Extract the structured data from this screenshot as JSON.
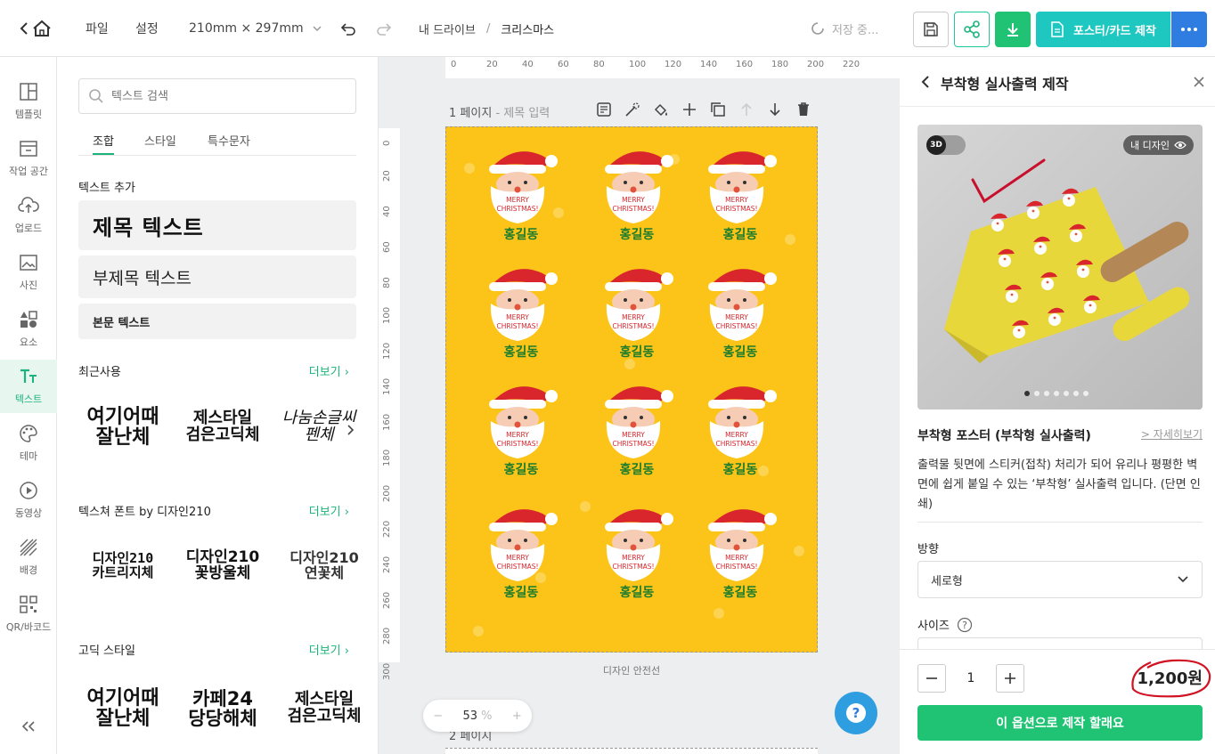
{
  "topbar": {
    "menu_file": "파일",
    "menu_settings": "설정",
    "paper_size": "210mm × 297mm",
    "breadcrumb_root": "내 드라이브",
    "breadcrumb_sep": "/",
    "breadcrumb_current": "크리스마스",
    "save_status": "저장 중...",
    "poster_button": "포스터/카드 제작"
  },
  "leftnav": {
    "items": [
      {
        "label": "템플릿",
        "icon": "template-icon"
      },
      {
        "label": "작업 공간",
        "icon": "workspace-icon"
      },
      {
        "label": "업로드",
        "icon": "upload-icon"
      },
      {
        "label": "사진",
        "icon": "photo-icon"
      },
      {
        "label": "요소",
        "icon": "elements-icon"
      },
      {
        "label": "텍스트",
        "icon": "text-icon"
      },
      {
        "label": "테마",
        "icon": "theme-icon"
      },
      {
        "label": "동영상",
        "icon": "video-icon"
      },
      {
        "label": "배경",
        "icon": "background-icon"
      },
      {
        "label": "QR/바코드",
        "icon": "qr-icon"
      }
    ],
    "active": "텍스트"
  },
  "textpanel": {
    "search_placeholder": "텍스트 검색",
    "tabs": [
      "조합",
      "스타일",
      "특수문자"
    ],
    "add_text_label": "텍스트 추가",
    "heading_text": "제목 텍스트",
    "subheading_text": "부제목 텍스트",
    "body_text": "본문 텍스트",
    "recent_label": "최근사용",
    "more_label": "더보기",
    "texture_label": "텍스쳐 폰트 by 디자인210",
    "gothic_label": "고딕 스타일",
    "recent_fonts": [
      {
        "line1": "여기어때",
        "line2": "잘난체"
      },
      {
        "line1": "제스타일",
        "line2": "검은고딕체"
      },
      {
        "line1": "나눔손글씨",
        "line2": "펜체"
      }
    ],
    "texture_fonts": [
      {
        "line1": "디자인210",
        "line2": "카트리지체"
      },
      {
        "line1": "디자인210",
        "line2": "꽃방울체"
      },
      {
        "line1": "디자인210",
        "line2": "연꽃체"
      }
    ],
    "gothic_fonts": [
      {
        "line1": "여기어때",
        "line2": "잘난체"
      },
      {
        "line1": "카페24",
        "line2": "당당해체"
      },
      {
        "line1": "제스타일",
        "line2": "검은고딕체"
      }
    ]
  },
  "canvas": {
    "page1_label": "1 페이지",
    "page1_title_placeholder": "- 제목 입력",
    "safe_line_label": "디자인 안전선",
    "page2_label": "2 페이지",
    "zoom_value": "53",
    "zoom_unit": "%",
    "ruler_top": [
      "0",
      "20",
      "40",
      "60",
      "80",
      "100",
      "120",
      "140",
      "160",
      "180",
      "200",
      "220"
    ],
    "ruler_left": [
      "0",
      "20",
      "40",
      "60",
      "80",
      "100",
      "120",
      "140",
      "160",
      "180",
      "200",
      "220",
      "240",
      "260",
      "280",
      "300"
    ],
    "santa_text_top": "MERRY",
    "santa_text_bottom": "CHRISTMAS!",
    "name_text": "홍길동",
    "background_color": "#fcc419",
    "grid_rows": 4,
    "grid_cols": 3
  },
  "rightpanel": {
    "title": "부착형 실사출력 제작",
    "toggle_3d": "3D",
    "my_design_badge": "내 디자인",
    "product_name": "부착형 포스터 (부착형 실사출력)",
    "details_link": "> 자세히보기",
    "description": "출력물 뒷면에 스티커(접착) 처리가 되어 유리나 평평한 벽면에 쉽게 붙일 수 있는 ‘부착형’ 실사출력 입니다. (단면 인쇄)",
    "direction_label": "방향",
    "direction_value": "세로형",
    "size_label": "사이즈",
    "quantity": "1",
    "price": "1,200원",
    "cta": "이 옵션으로 제작 할래요"
  },
  "colors": {
    "accent": "#1bb47a",
    "teal": "#1ec8c1",
    "blue": "#2f7de1",
    "canvas_bg": "#fcc419",
    "name_green": "#1b7c2c"
  }
}
